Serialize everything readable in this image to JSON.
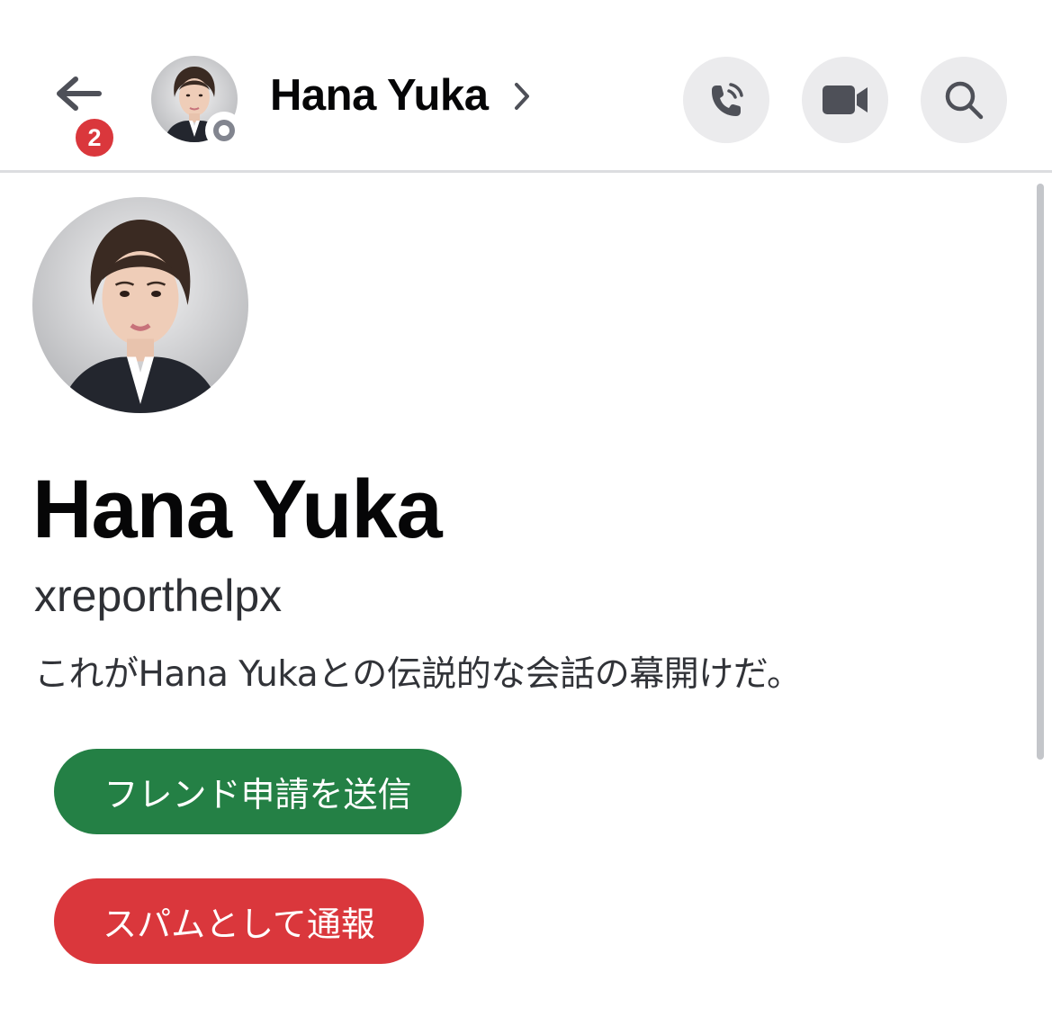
{
  "header": {
    "back_badge_count": "2",
    "name": "Hana Yuka",
    "status": "offline"
  },
  "profile": {
    "display_name": "Hana Yuka",
    "username": "xreporthelpx",
    "intro": "これがHana Yukaとの伝説的な会話の幕開けだ。"
  },
  "actions": {
    "friend_request_label": "フレンド申請を送信",
    "report_spam_label": "スパムとして通報"
  },
  "colors": {
    "friend_button": "#248045",
    "report_button": "#da373c",
    "badge": "#da373c"
  },
  "icons": {
    "back": "arrow-left-icon",
    "call": "phone-icon",
    "video": "video-camera-icon",
    "search": "search-icon",
    "chevron": "chevron-right-icon"
  }
}
